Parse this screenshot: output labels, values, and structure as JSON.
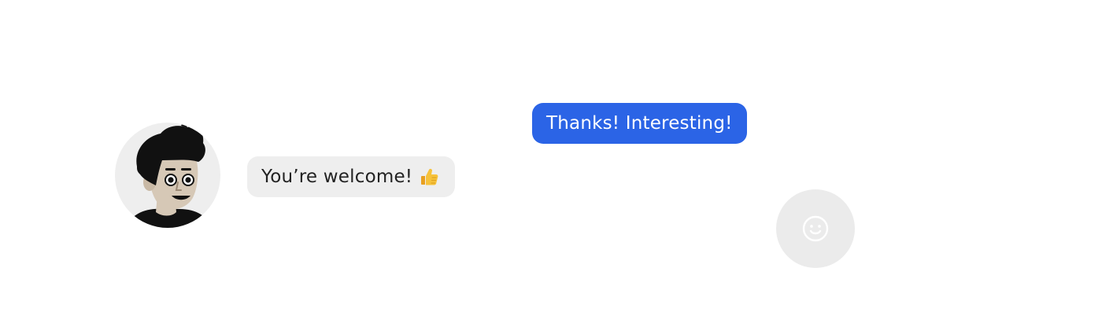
{
  "chat": {
    "outgoing_message": {
      "text": "Thanks! Interesting!",
      "bubble_color": "#2B64E6",
      "text_color": "#FFFFFF"
    },
    "incoming_message": {
      "text": "You’re welcome!",
      "emoji": "thumbs-up-emoji",
      "bubble_color": "#EEEEEE",
      "text_color": "#222222"
    },
    "avatar": {
      "icon": "cartoon-person-avatar",
      "background_color": "#EEEEEE"
    },
    "emoji_button": {
      "icon": "smiley-face-icon",
      "background_color": "#EBEBEB",
      "icon_color": "#FFFFFF"
    }
  }
}
